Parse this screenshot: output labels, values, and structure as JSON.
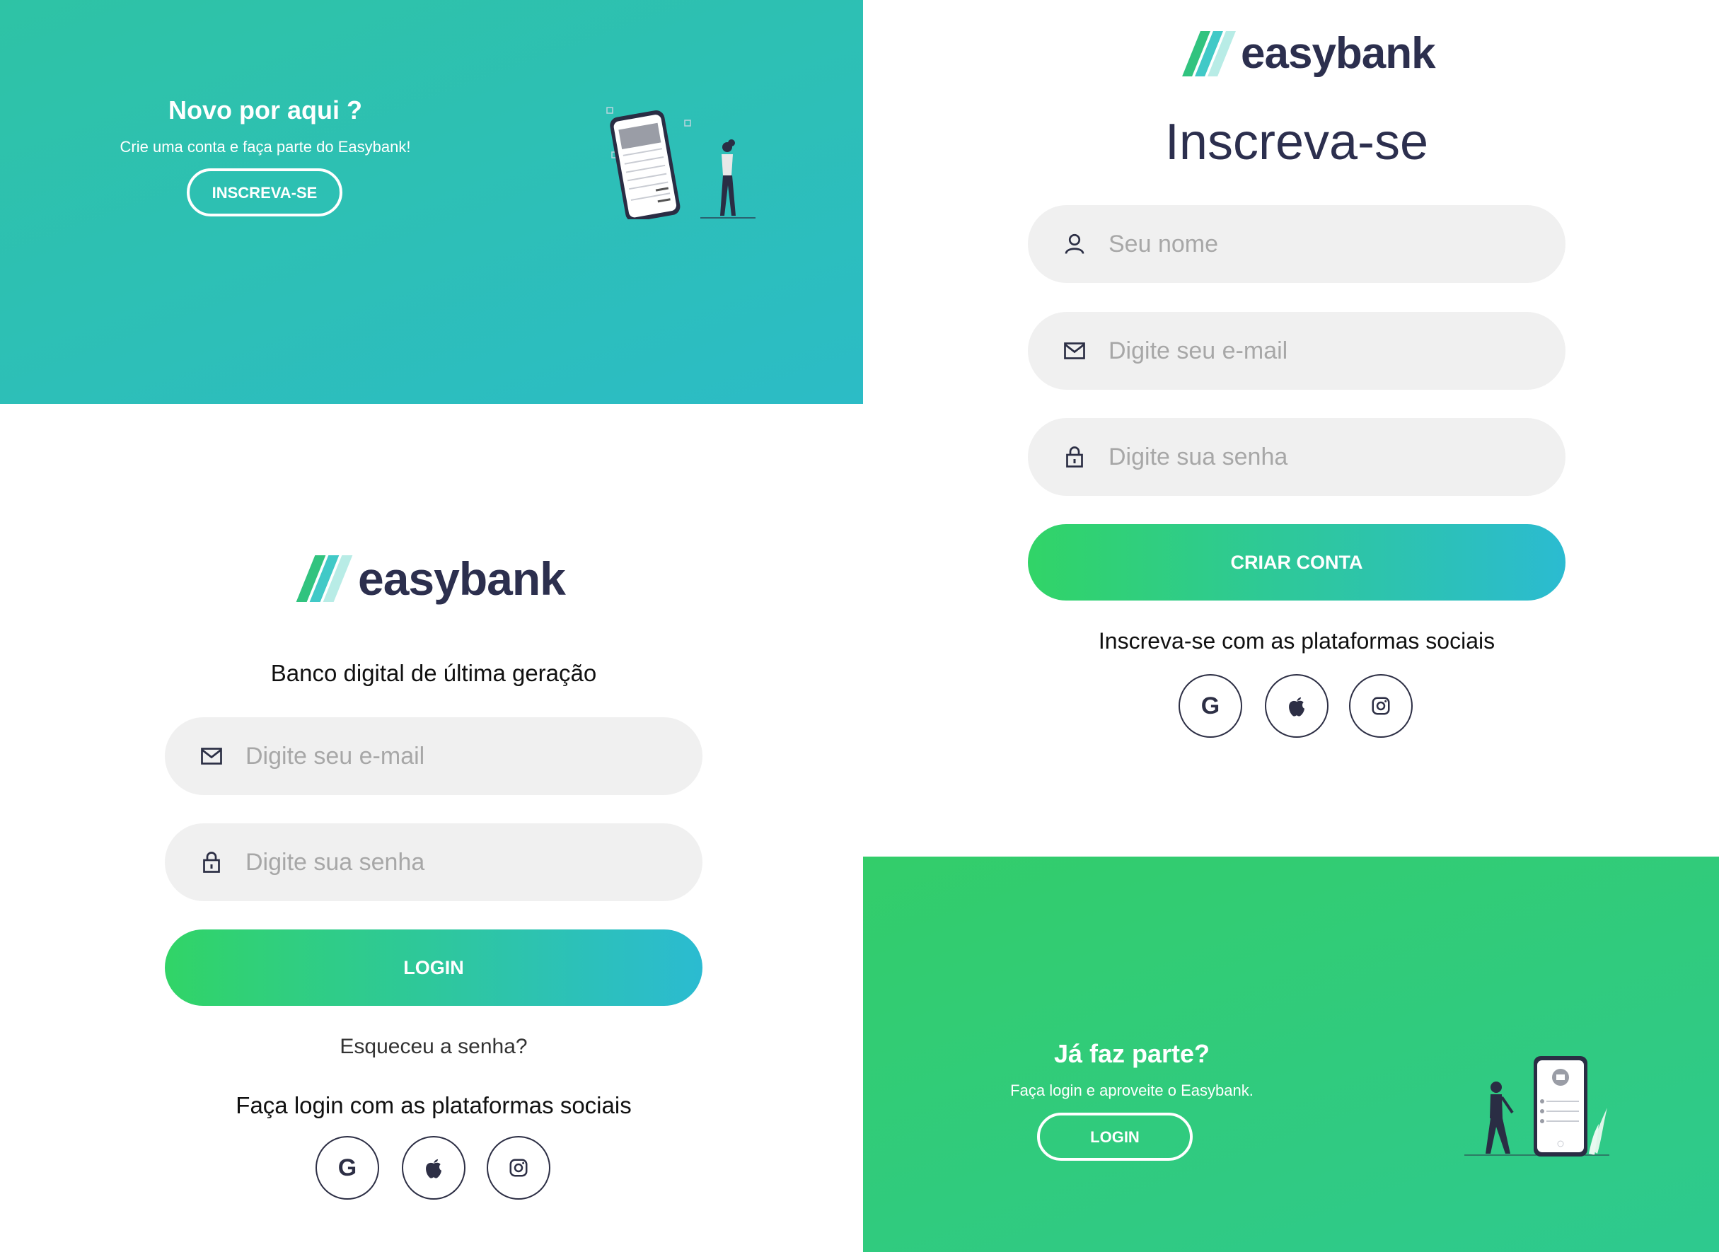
{
  "signup_promo": {
    "title": "Novo por aqui ?",
    "subtitle": "Crie uma conta e faça parte do Easybank!",
    "button_label": "INSCREVA-SE",
    "background_color": "#2ec3b0"
  },
  "login_promo": {
    "title": "Já faz parte?",
    "subtitle": "Faça login e aproveite o Easybank.",
    "button_label": "LOGIN",
    "background_color": "#33cc7c"
  },
  "brand": {
    "name": "easybank",
    "text_color": "#2c2f4e"
  },
  "signup_form": {
    "title": "Inscreva-se",
    "name_placeholder": "Seu nome",
    "email_placeholder": "Digite seu e-mail",
    "password_placeholder": "Digite sua senha",
    "submit_label": "CRIAR CONTA",
    "social_text": "Inscreva-se com as plataformas sociais"
  },
  "login_form": {
    "tagline": "Banco digital de última geração",
    "email_placeholder": "Digite seu e-mail",
    "password_placeholder": "Digite sua senha",
    "submit_label": "LOGIN",
    "forgot_label": "Esqueceu a senha?",
    "social_text": "Faça login com as plataformas sociais"
  },
  "social": {
    "google_glyph": "G",
    "icons": [
      "google-icon",
      "apple-icon",
      "instagram-icon"
    ]
  },
  "colors": {
    "gradient_start": "#31d467",
    "gradient_end": "#2bbbd1",
    "input_background": "#f0f0f0",
    "placeholder": "#a7a7a7"
  }
}
